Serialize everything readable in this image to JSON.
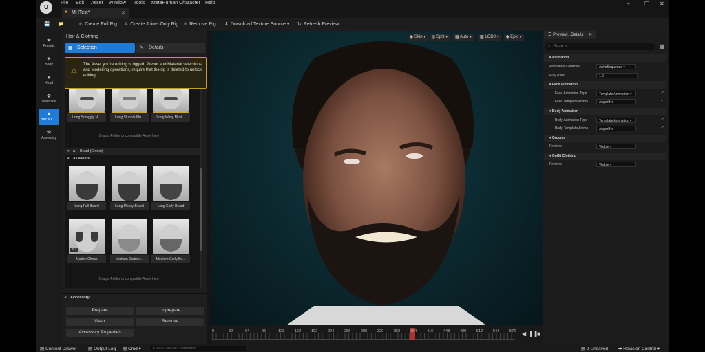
{
  "menu": {
    "items": [
      "File",
      "Edit",
      "Asset",
      "Window",
      "Tools",
      "MetaHuman Character",
      "Help"
    ]
  },
  "tab": {
    "title": "MHTest*"
  },
  "toolbar": {
    "create_full_rig": "Create Full Rig",
    "create_joints_only_rig": "Create Joints Only Rig",
    "remove_rig": "Remove Rig",
    "download_texture_source": "Download Texture Source",
    "refresh_preview": "Refresh Preview"
  },
  "sidebar": {
    "items": [
      {
        "label": "Presets",
        "icon": "star-icon"
      },
      {
        "label": "Body",
        "icon": "body-icon"
      },
      {
        "label": "Head",
        "icon": "head-icon"
      },
      {
        "label": "Materials",
        "icon": "palette-icon"
      },
      {
        "label": "Hair & Cl...",
        "icon": "hair-icon"
      },
      {
        "label": "Assembly",
        "icon": "hammer-icon"
      }
    ]
  },
  "left_panel": {
    "title": "Hair & Clothing",
    "selection_tab": "Selection",
    "details_tab": "Details",
    "warning": "The Asset you're editing is rigged. Preset and Material selections,\nand Modelling operations, require that the rig is deleted to unlock editing.",
    "mustache_items": [
      "Long Scraggly M...",
      "Long Stubble Mu...",
      "Long Wavy Must..."
    ],
    "drag_hint": "Drag a Folder or compatible Asset here",
    "beard_section": "Beard (Groom)",
    "all_assets": "All Assets",
    "beard_items": [
      "Long Full Beard",
      "Long Messy Beard",
      "Long Curly Beard",
      "Mutton Chops",
      "Medium Stubble...",
      "Medium Curly Be..."
    ]
  },
  "accessory": {
    "title": "Accessory",
    "prepare": "Prepare",
    "unprepare": "Unprepare",
    "wear": "Wear",
    "remove": "Remove",
    "properties": "Accessory Properties"
  },
  "viewport": {
    "pills": [
      "Skin",
      "Split",
      "Auto",
      "LOD0",
      "Epic"
    ]
  },
  "timeline": {
    "ticks": [
      "0",
      "32",
      "64",
      "96",
      "128",
      "160",
      "192",
      "224",
      "256",
      "288",
      "320",
      "352",
      "384",
      "416",
      "448",
      "480",
      "512",
      "544",
      "576"
    ],
    "current": 384
  },
  "details": {
    "tab": "Preview...Details",
    "search_placeholder": "Search",
    "categories": {
      "animation": "Animation",
      "face_animation": "Face Animation",
      "body_animation": "Body Animation",
      "grooms": "Grooms",
      "outfit_clothing": "Outfit Clothing"
    },
    "props": {
      "animation_controller": {
        "label": "Animation Controller",
        "value": "AnimSequence"
      },
      "play_rate": {
        "label": "Play Rate",
        "value": "1.0"
      },
      "face_animation_type": {
        "label": "Face Animation Type",
        "value": "Template Animation"
      },
      "face_template_anim": {
        "label": "Face Template Anima...",
        "value": "AngerB"
      },
      "body_animation_type": {
        "label": "Body Animation Type",
        "value": "Template Animation"
      },
      "body_template_anim": {
        "label": "Body Template Anima...",
        "value": "AngerB"
      },
      "grooms_preview": {
        "label": "Preview",
        "value": "Visible"
      },
      "outfit_preview": {
        "label": "Preview",
        "value": "Visible"
      }
    }
  },
  "statusbar": {
    "content_drawer": "Content Drawer",
    "output_log": "Output Log",
    "cmd": "Cmd",
    "console_placeholder": "Enter Console Command",
    "unsaved": "2 Unsaved",
    "revision_control": "Revision Control"
  },
  "colors": {
    "accent": "#1f7bd8",
    "warning": "#c59b2e",
    "viewport_bg": "#0c2a31"
  }
}
